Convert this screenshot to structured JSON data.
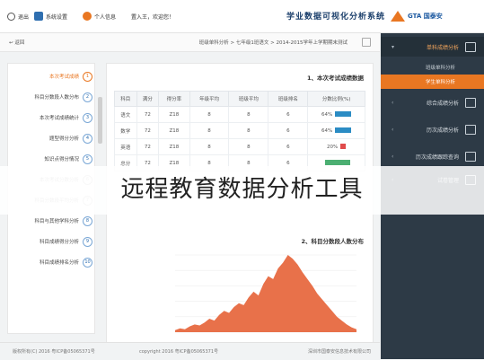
{
  "topbar": {
    "exit_label": "退出",
    "settings_label": "系统设置",
    "user_label": "个人信息",
    "welcome": "置入王，欢迎您！",
    "system_title": "学业数据可视化分析系统",
    "logo_text": "GTA 国泰安"
  },
  "breadcrumb": {
    "back": "返回",
    "path": "班级单科分析 > 七年级1班语文 > 2014-2015学年上学期期末测试"
  },
  "nav": {
    "items": [
      {
        "label": "单科成绩分析",
        "active": true
      },
      {
        "label": "综合成绩分析"
      },
      {
        "label": "历次成绩分析"
      },
      {
        "label": "历次成绩跟踪查询"
      },
      {
        "label": "试卷管理"
      }
    ],
    "sub_items": [
      {
        "label": "班级单科分析"
      },
      {
        "label": "学生单科分析",
        "active": true
      }
    ]
  },
  "steps": [
    {
      "num": "1",
      "label": "本次考试成绩",
      "state": "active"
    },
    {
      "num": "2",
      "label": "科目分数段人数分布",
      "state": ""
    },
    {
      "num": "3",
      "label": "本次考试成绩统计",
      "state": ""
    },
    {
      "num": "4",
      "label": "题型得分分析",
      "state": ""
    },
    {
      "num": "5",
      "label": "知识点得分情况",
      "state": ""
    },
    {
      "num": "6",
      "label": "本次考试分数分析",
      "state": "dim"
    },
    {
      "num": "7",
      "label": "科目分数段平均分析",
      "state": "dim"
    },
    {
      "num": "8",
      "label": "科目与其他学科分析",
      "state": ""
    },
    {
      "num": "9",
      "label": "科目成绩得分分析",
      "state": ""
    },
    {
      "num": "10",
      "label": "科目成绩排名分析",
      "state": ""
    }
  ],
  "content": {
    "section1_title": "1、本次考试成绩数据",
    "section2_title": "2、科目分数段人数分布",
    "table": {
      "headers": [
        "科目",
        "满分",
        "得分率",
        "年级平均",
        "班级平均",
        "班级排名",
        "分数比例(%)"
      ],
      "rows": [
        {
          "subject": "语文",
          "full": "72",
          "rate": "Z18",
          "grade_avg": "8",
          "class_avg": "8",
          "rank": "6",
          "pct": "64%",
          "bar": 0.64,
          "color": "#2b8cc4"
        },
        {
          "subject": "数学",
          "full": "72",
          "rate": "Z18",
          "grade_avg": "8",
          "class_avg": "8",
          "rank": "6",
          "pct": "64%",
          "bar": 0.64,
          "color": "#2b8cc4"
        },
        {
          "subject": "英语",
          "full": "72",
          "rate": "Z18",
          "grade_avg": "8",
          "class_avg": "8",
          "rank": "6",
          "pct": "20%",
          "bar": 0.2,
          "color": "#e04b4b"
        },
        {
          "subject": "总分",
          "full": "72",
          "rate": "Z18",
          "grade_avg": "8",
          "class_avg": "8",
          "rank": "6",
          "pct": "",
          "bar": 1.0,
          "color": "#4caf72"
        }
      ]
    }
  },
  "chart_data": {
    "type": "area",
    "title": "2、科目分数段人数分布",
    "color": "#e8714a",
    "values": [
      2,
      4,
      3,
      6,
      8,
      7,
      10,
      14,
      12,
      18,
      22,
      20,
      26,
      30,
      28,
      36,
      42,
      38,
      50,
      58,
      55,
      66,
      72,
      80,
      76,
      70,
      62,
      55,
      48,
      40,
      34,
      28,
      22,
      16,
      12,
      8,
      5,
      3
    ]
  },
  "footer": {
    "left": "版权所有(C) 2016 粤ICP备05065371号",
    "mid": "copyright 2016 粤ICP备05065371号",
    "right": "深圳市国泰安信息技术有限公司"
  },
  "watermark": "远程教育数据分析工具"
}
